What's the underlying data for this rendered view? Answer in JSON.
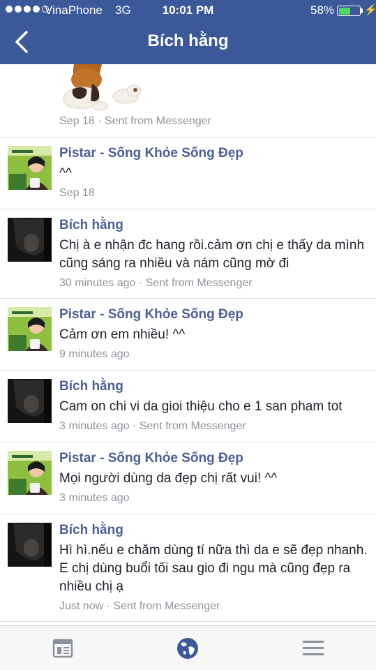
{
  "status_bar": {
    "carrier": "VinaPhone",
    "network": "3G",
    "time": "10:01 PM",
    "battery_percent": "58%",
    "battery_level": 0.58
  },
  "header": {
    "title": "Bích hằng",
    "back_icon": "chevron-left-icon"
  },
  "colors": {
    "header_bg": "#3b5998",
    "sender": "#4b6195",
    "meta": "#90949c",
    "battery": "#4cd964"
  },
  "feed": {
    "partial_item": {
      "meta": "Sep 18 · Sent from Messenger"
    },
    "items": [
      {
        "sender": "Pistar - Sống Khỏe Sống Đẹp",
        "text": "^^",
        "meta": "Sep 18"
      },
      {
        "sender": "Bích hằng",
        "text": "Chị à e nhận đc hang rồi.cảm ơn chị e thấy da mình cũng sáng ra nhiều và nám cũng mờ đi",
        "meta": "30 minutes ago · Sent from Messenger"
      },
      {
        "sender": "Pistar - Sống Khỏe Sống Đẹp",
        "text": "Cảm ơn em nhiều! ^^",
        "meta": "9 minutes ago"
      },
      {
        "sender": "Bích hằng",
        "text": "Cam on chi vi da gioi thiệu cho e 1 san pham tot",
        "meta": "3 minutes ago · Sent from Messenger"
      },
      {
        "sender": "Pistar - Sống Khỏe Sống Đẹp",
        "text": "Mọi người dùng da đẹp chị rất vui! ^^",
        "meta": "3 minutes ago"
      },
      {
        "sender": "Bích hằng",
        "text": "Hì hì.nếu e chăm dùng tí nữa thì da e sẽ đẹp nhanh. E chị dùng buổi tối sau gio đi ngu mà cũng đẹp ra nhiều chị ạ",
        "meta": "Just now · Sent from Messenger"
      }
    ]
  },
  "tabbar": {
    "tabs": [
      "news-feed-icon",
      "globe-icon",
      "menu-icon"
    ]
  }
}
